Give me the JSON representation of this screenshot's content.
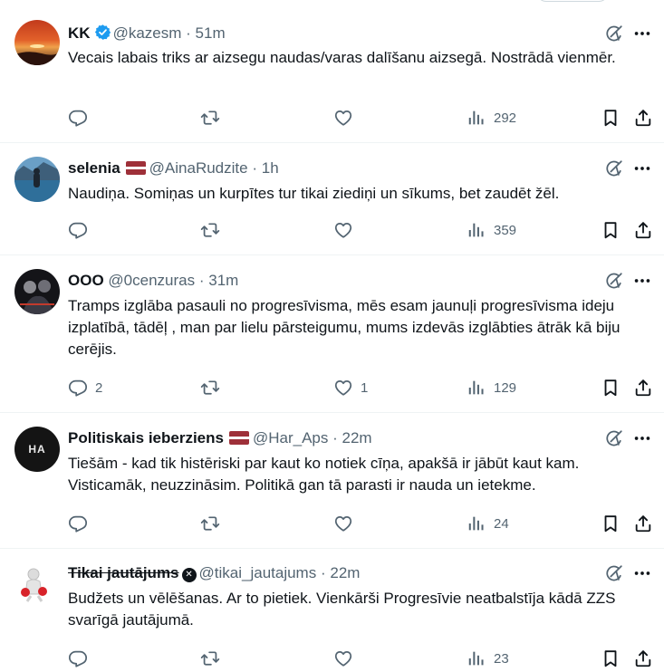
{
  "tweets": [
    {
      "name": "KK",
      "verified": true,
      "handle": "@kazesm",
      "separator": "·",
      "time": "51m",
      "text": "Vecais labais triks  ar aizsegu naudas/varas dalīšanu aizsegā.  Nostrādā vienmēr.",
      "replies": "",
      "likes": "",
      "views": "292"
    },
    {
      "name": "selenia",
      "flag": "latvia",
      "handle": "@AinaRudzite",
      "separator": "·",
      "time": "1h",
      "text": "Naudiņa. Somiņas un kurpītes tur tikai ziediņi un sīkums, bet zaudēt žēl.",
      "replies": "",
      "likes": "",
      "views": "359"
    },
    {
      "name": "OOO",
      "handle": "@0cenzuras",
      "separator": "·",
      "time": "31m",
      "text": "Tramps izglāba pasauli no progresīvisma, mēs esam jaunuļi progresīvisma ideju izplatībā, tādēļ , man par lielu pārsteigumu, mums izdevās izglābties ātrāk kā biju cerējis.",
      "replies": "2",
      "likes": "1",
      "views": "129"
    },
    {
      "name": "Politiskais ieberziens",
      "flag": "latvia",
      "handle": "@Har_Aps",
      "separator": "·",
      "time": "22m",
      "avatar_text": "HA",
      "text": "Tiešām - kad tik histēriski par kaut ko notiek cīņa, apakšā ir jābūt kaut kam. Visticamāk, neuzzināsim. Politikā gan tā parasti ir nauda un ietekme.",
      "replies": "",
      "likes": "",
      "views": "24"
    },
    {
      "name": "Tikai jautājums",
      "badge": "x-logo",
      "handle": "@tikai_jautajums",
      "separator": "·",
      "time": "22m",
      "text": "Budžets un vēlēšanas. Ar to pietiek. Vienkārši Progresīvie neatbalstīja kādā ZZS svarīgā jautājumā.",
      "replies": "",
      "likes": "",
      "views": "23"
    }
  ],
  "icons": {
    "grok": "grok-icon",
    "more": "more-icon",
    "reply": "reply-icon",
    "retweet": "retweet-icon",
    "like": "like-icon",
    "views": "views-icon",
    "bookmark": "bookmark-icon",
    "share": "share-icon"
  },
  "colors": {
    "text": "#0f1419",
    "muted": "#536471",
    "verified": "#1d9bf0",
    "flag_red": "#9e3039",
    "divider": "#eff3f4"
  }
}
